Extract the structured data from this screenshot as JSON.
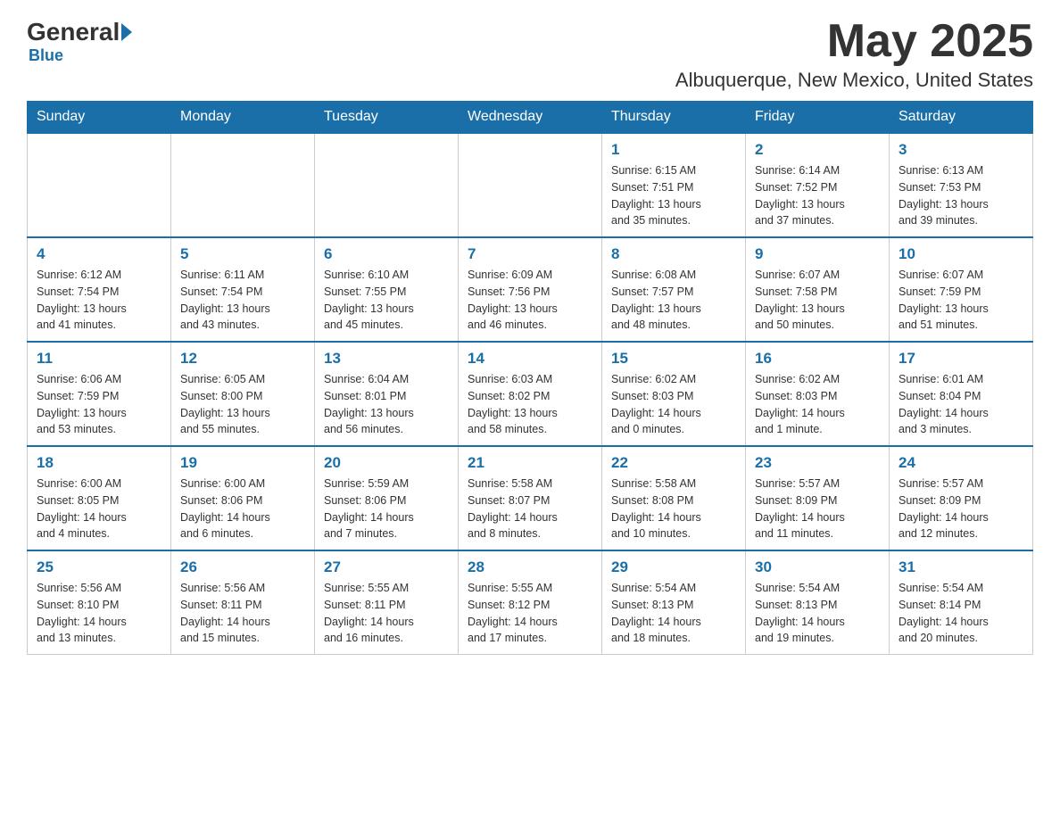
{
  "header": {
    "logo_text": "General",
    "logo_blue": "Blue",
    "month": "May 2025",
    "location": "Albuquerque, New Mexico, United States"
  },
  "days_of_week": [
    "Sunday",
    "Monday",
    "Tuesday",
    "Wednesday",
    "Thursday",
    "Friday",
    "Saturday"
  ],
  "weeks": [
    [
      {
        "day": "",
        "info": ""
      },
      {
        "day": "",
        "info": ""
      },
      {
        "day": "",
        "info": ""
      },
      {
        "day": "",
        "info": ""
      },
      {
        "day": "1",
        "info": "Sunrise: 6:15 AM\nSunset: 7:51 PM\nDaylight: 13 hours\nand 35 minutes."
      },
      {
        "day": "2",
        "info": "Sunrise: 6:14 AM\nSunset: 7:52 PM\nDaylight: 13 hours\nand 37 minutes."
      },
      {
        "day": "3",
        "info": "Sunrise: 6:13 AM\nSunset: 7:53 PM\nDaylight: 13 hours\nand 39 minutes."
      }
    ],
    [
      {
        "day": "4",
        "info": "Sunrise: 6:12 AM\nSunset: 7:54 PM\nDaylight: 13 hours\nand 41 minutes."
      },
      {
        "day": "5",
        "info": "Sunrise: 6:11 AM\nSunset: 7:54 PM\nDaylight: 13 hours\nand 43 minutes."
      },
      {
        "day": "6",
        "info": "Sunrise: 6:10 AM\nSunset: 7:55 PM\nDaylight: 13 hours\nand 45 minutes."
      },
      {
        "day": "7",
        "info": "Sunrise: 6:09 AM\nSunset: 7:56 PM\nDaylight: 13 hours\nand 46 minutes."
      },
      {
        "day": "8",
        "info": "Sunrise: 6:08 AM\nSunset: 7:57 PM\nDaylight: 13 hours\nand 48 minutes."
      },
      {
        "day": "9",
        "info": "Sunrise: 6:07 AM\nSunset: 7:58 PM\nDaylight: 13 hours\nand 50 minutes."
      },
      {
        "day": "10",
        "info": "Sunrise: 6:07 AM\nSunset: 7:59 PM\nDaylight: 13 hours\nand 51 minutes."
      }
    ],
    [
      {
        "day": "11",
        "info": "Sunrise: 6:06 AM\nSunset: 7:59 PM\nDaylight: 13 hours\nand 53 minutes."
      },
      {
        "day": "12",
        "info": "Sunrise: 6:05 AM\nSunset: 8:00 PM\nDaylight: 13 hours\nand 55 minutes."
      },
      {
        "day": "13",
        "info": "Sunrise: 6:04 AM\nSunset: 8:01 PM\nDaylight: 13 hours\nand 56 minutes."
      },
      {
        "day": "14",
        "info": "Sunrise: 6:03 AM\nSunset: 8:02 PM\nDaylight: 13 hours\nand 58 minutes."
      },
      {
        "day": "15",
        "info": "Sunrise: 6:02 AM\nSunset: 8:03 PM\nDaylight: 14 hours\nand 0 minutes."
      },
      {
        "day": "16",
        "info": "Sunrise: 6:02 AM\nSunset: 8:03 PM\nDaylight: 14 hours\nand 1 minute."
      },
      {
        "day": "17",
        "info": "Sunrise: 6:01 AM\nSunset: 8:04 PM\nDaylight: 14 hours\nand 3 minutes."
      }
    ],
    [
      {
        "day": "18",
        "info": "Sunrise: 6:00 AM\nSunset: 8:05 PM\nDaylight: 14 hours\nand 4 minutes."
      },
      {
        "day": "19",
        "info": "Sunrise: 6:00 AM\nSunset: 8:06 PM\nDaylight: 14 hours\nand 6 minutes."
      },
      {
        "day": "20",
        "info": "Sunrise: 5:59 AM\nSunset: 8:06 PM\nDaylight: 14 hours\nand 7 minutes."
      },
      {
        "day": "21",
        "info": "Sunrise: 5:58 AM\nSunset: 8:07 PM\nDaylight: 14 hours\nand 8 minutes."
      },
      {
        "day": "22",
        "info": "Sunrise: 5:58 AM\nSunset: 8:08 PM\nDaylight: 14 hours\nand 10 minutes."
      },
      {
        "day": "23",
        "info": "Sunrise: 5:57 AM\nSunset: 8:09 PM\nDaylight: 14 hours\nand 11 minutes."
      },
      {
        "day": "24",
        "info": "Sunrise: 5:57 AM\nSunset: 8:09 PM\nDaylight: 14 hours\nand 12 minutes."
      }
    ],
    [
      {
        "day": "25",
        "info": "Sunrise: 5:56 AM\nSunset: 8:10 PM\nDaylight: 14 hours\nand 13 minutes."
      },
      {
        "day": "26",
        "info": "Sunrise: 5:56 AM\nSunset: 8:11 PM\nDaylight: 14 hours\nand 15 minutes."
      },
      {
        "day": "27",
        "info": "Sunrise: 5:55 AM\nSunset: 8:11 PM\nDaylight: 14 hours\nand 16 minutes."
      },
      {
        "day": "28",
        "info": "Sunrise: 5:55 AM\nSunset: 8:12 PM\nDaylight: 14 hours\nand 17 minutes."
      },
      {
        "day": "29",
        "info": "Sunrise: 5:54 AM\nSunset: 8:13 PM\nDaylight: 14 hours\nand 18 minutes."
      },
      {
        "day": "30",
        "info": "Sunrise: 5:54 AM\nSunset: 8:13 PM\nDaylight: 14 hours\nand 19 minutes."
      },
      {
        "day": "31",
        "info": "Sunrise: 5:54 AM\nSunset: 8:14 PM\nDaylight: 14 hours\nand 20 minutes."
      }
    ]
  ]
}
